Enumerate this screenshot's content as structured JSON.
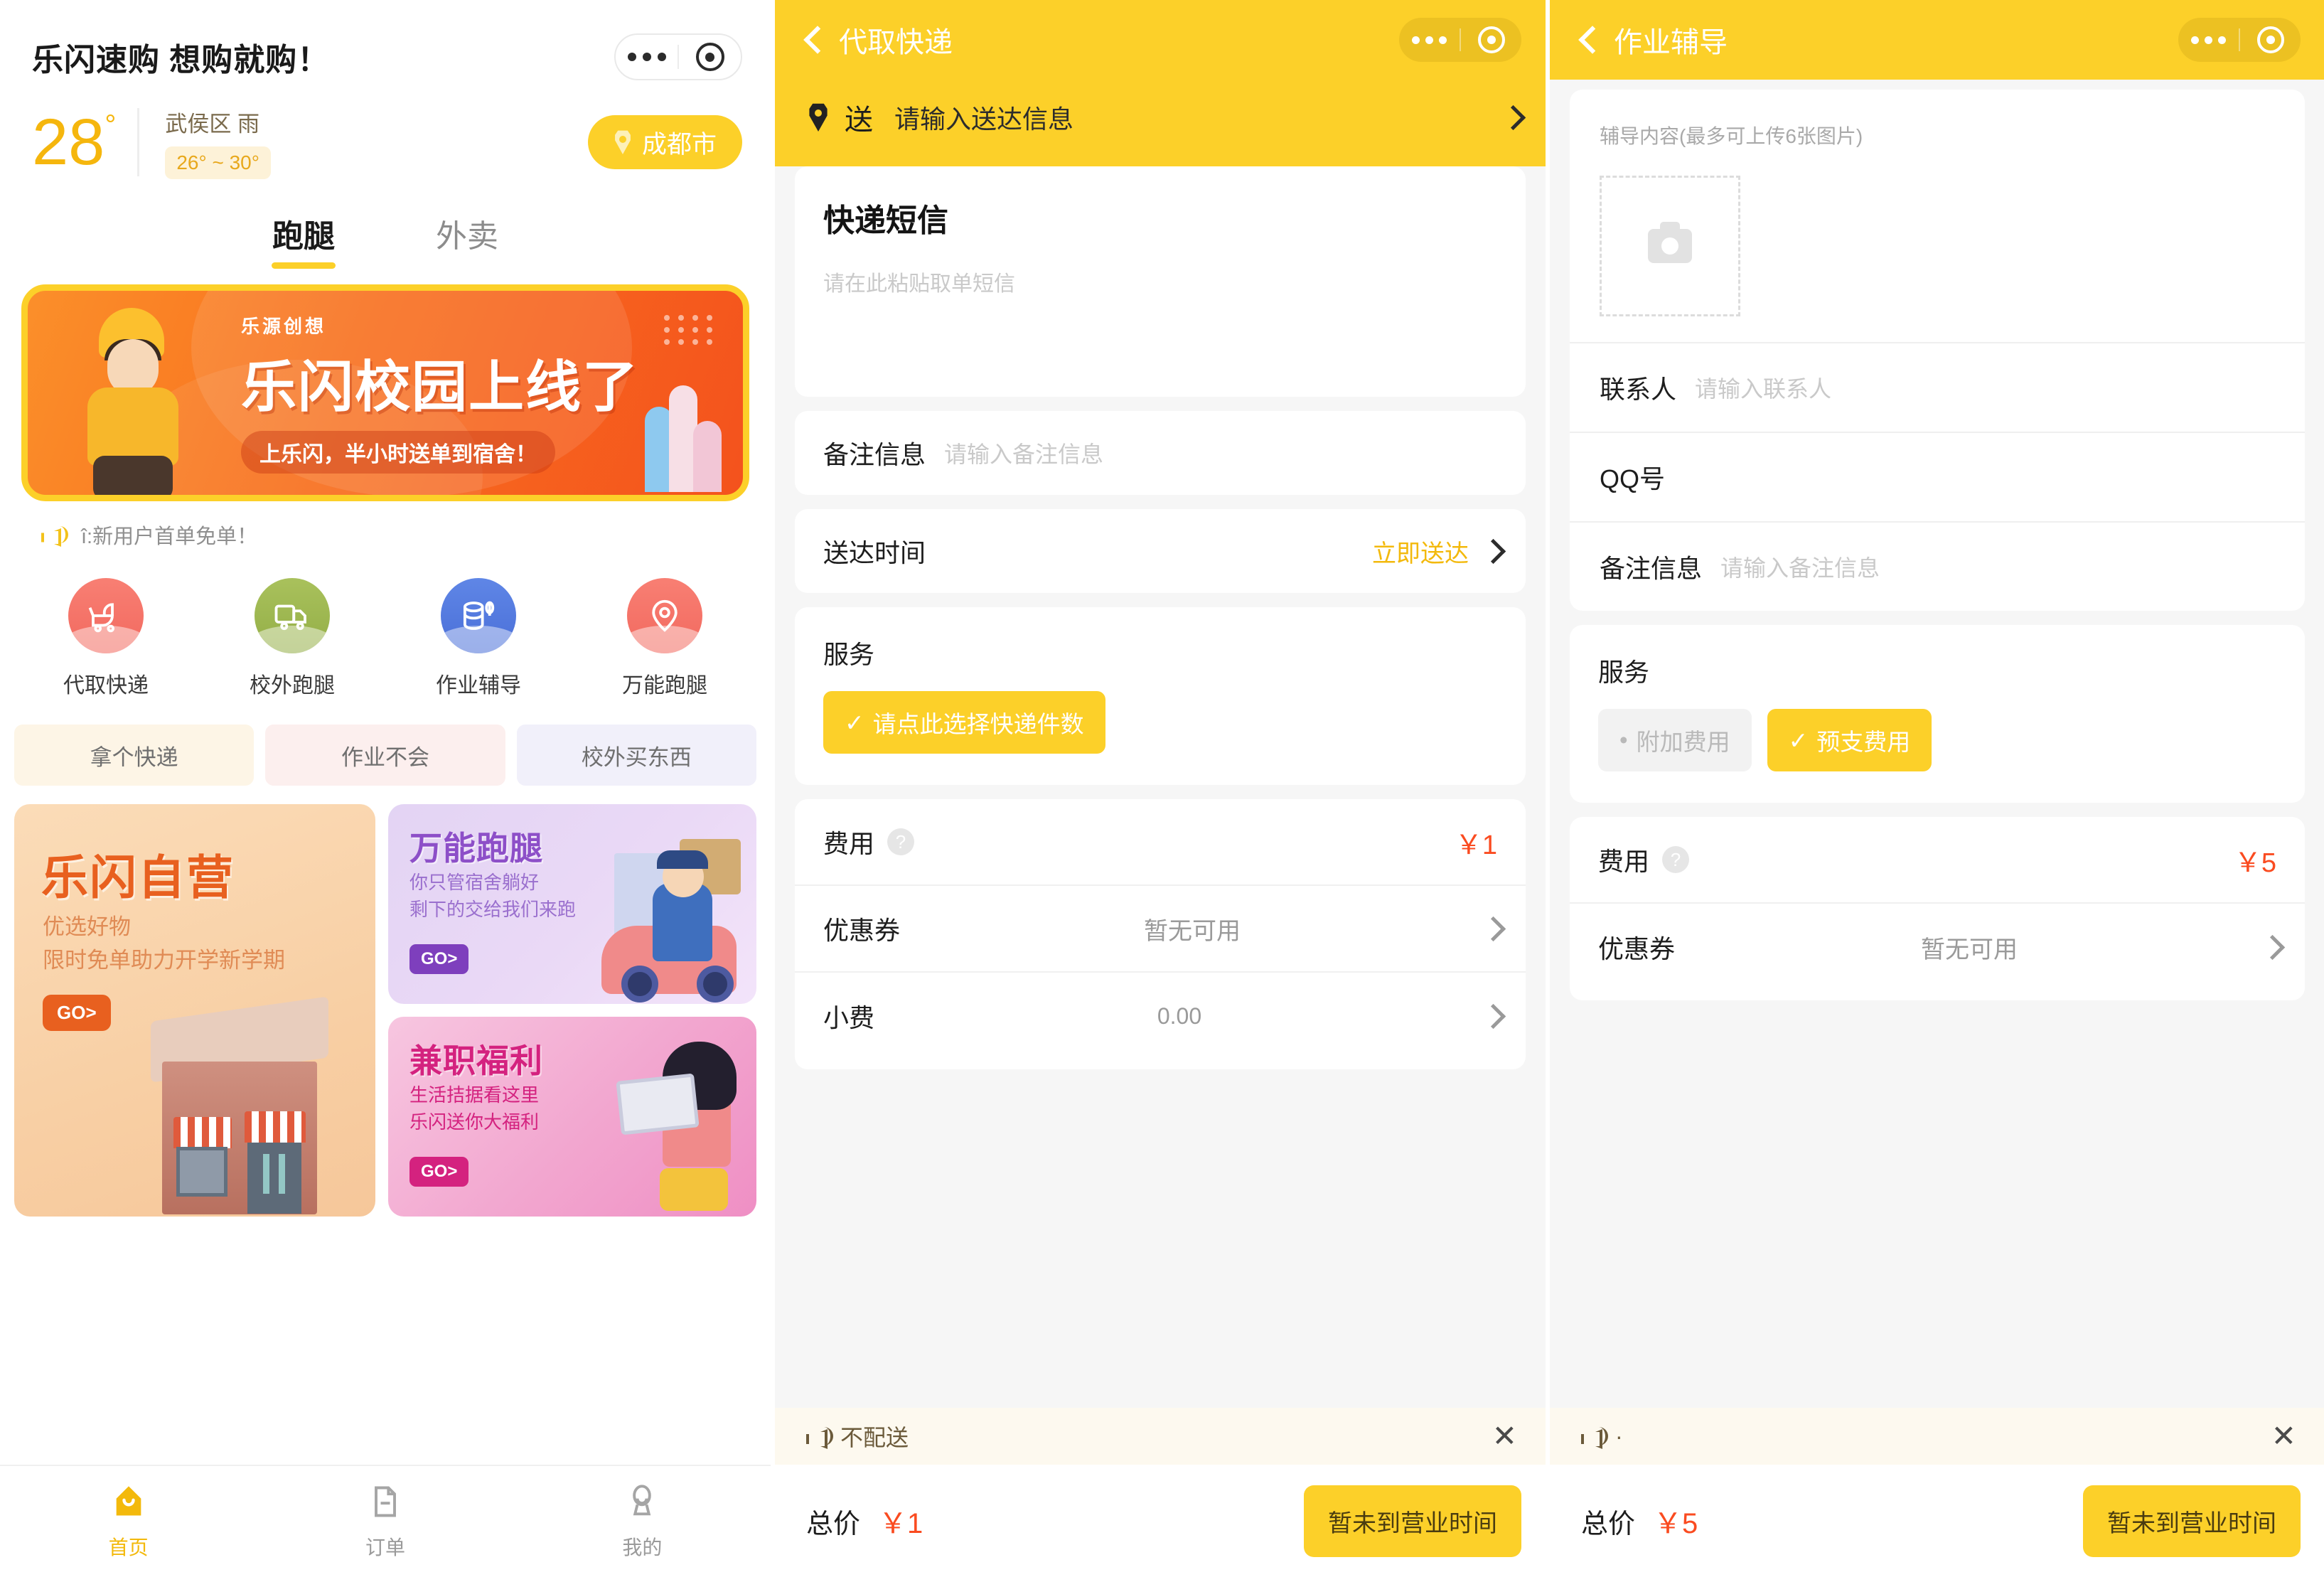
{
  "home": {
    "title": "乐闪速购 想购就购！",
    "weather": {
      "temp": "28",
      "degree": "°",
      "district": "武侯区 雨",
      "range": "26° ~ 30°"
    },
    "city_button": "成都市",
    "tabs": [
      {
        "label": "跑腿",
        "active": true
      },
      {
        "label": "外卖",
        "active": false
      }
    ],
    "banner": {
      "brand": "乐源创想",
      "headline": "乐闪校园上线了",
      "subline": "上乐闪，半小时送单到宿舍！"
    },
    "notice": "î:新用户首单免单！",
    "services": [
      {
        "label": "代取快递",
        "icon": "stroller-icon"
      },
      {
        "label": "校外跑腿",
        "icon": "truck-icon"
      },
      {
        "label": "作业辅导",
        "icon": "food-icon"
      },
      {
        "label": "万能跑腿",
        "icon": "location-pin-icon"
      }
    ],
    "chips": [
      "拿个快递",
      "作业不会",
      "校外买东西"
    ],
    "promo_left": {
      "title": "乐闪自营",
      "line1": "优选好物",
      "line2": "限时免单助力开学新学期",
      "go": "GO>"
    },
    "promo_right": [
      {
        "title": "万能跑腿",
        "line1": "你只管宿舍躺好",
        "line2": "剩下的交给我们来跑",
        "go": "GO>"
      },
      {
        "title": "兼职福利",
        "line1": "生活拮据看这里",
        "line2": "乐闪送你大福利",
        "go": "GO>"
      }
    ],
    "tabbar": [
      {
        "label": "首页",
        "icon": "home-icon",
        "active": true
      },
      {
        "label": "订单",
        "icon": "order-doc-icon",
        "active": false
      },
      {
        "label": "我的",
        "icon": "person-icon",
        "active": false
      }
    ]
  },
  "express": {
    "nav_title": "代取快递",
    "address": {
      "label": "送",
      "placeholder": "请输入送达信息"
    },
    "sms": {
      "title": "快递短信",
      "placeholder": "请在此粘贴取单短信"
    },
    "remark": {
      "label": "备注信息",
      "placeholder": "请输入备注信息"
    },
    "delivery_time": {
      "label": "送达时间",
      "value": "立即送达"
    },
    "service": {
      "label": "服务",
      "button": "请点此选择快递件数"
    },
    "fees": [
      {
        "label": "费用",
        "value": "￥1",
        "type": "price",
        "has_help": true
      },
      {
        "label": "优惠券",
        "value": "暂无可用",
        "type": "grey",
        "has_chevron": true
      },
      {
        "label": "小费",
        "value": "0.00",
        "type": "tip",
        "has_chevron": true
      }
    ],
    "bottom_notice": "不配送",
    "total_label": "总价",
    "total_value": "￥1",
    "pay_button": "暂未到营业时间"
  },
  "tutoring": {
    "nav_title": "作业辅导",
    "upload": {
      "title": "辅导内容",
      "hint": "(最多可上传6张图片)",
      "icon": "camera-icon"
    },
    "fields": [
      {
        "label": "联系人",
        "placeholder": "请输入联系人"
      },
      {
        "label": "QQ号",
        "placeholder": ""
      },
      {
        "label": "备注信息",
        "placeholder": "请输入备注信息"
      }
    ],
    "service": {
      "label": "服务",
      "buttons": [
        {
          "label": "附加费用",
          "selected": false
        },
        {
          "label": "预支费用",
          "selected": true
        }
      ]
    },
    "fees": [
      {
        "label": "费用",
        "value": "￥5",
        "type": "price",
        "has_help": true
      },
      {
        "label": "优惠券",
        "value": "暂无可用",
        "type": "grey",
        "has_chevron": true
      }
    ],
    "bottom_notice": "·",
    "total_label": "总价",
    "total_value": "￥5",
    "pay_button": "暂未到营业时间"
  },
  "colors": {
    "brand_yellow": "#fcd029",
    "price_red": "#fa4b20",
    "accent_orange": "#e8601f",
    "muted": "#9a9a9a"
  }
}
